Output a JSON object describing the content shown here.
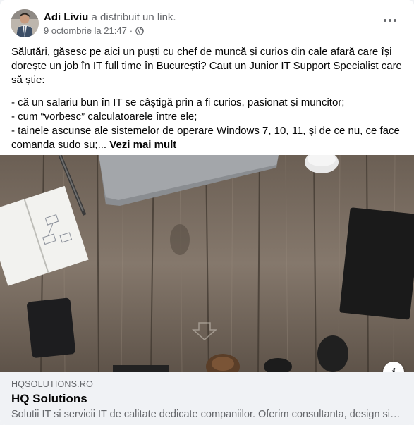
{
  "post": {
    "author_name": "Adi Liviu",
    "action_text": "a distribuit un link.",
    "timestamp": "9 octombrie la 21:47",
    "separator": "·",
    "privacy_icon": "globe-icon",
    "more_icon": "more-options-icon",
    "intro": "Sălutări, găsesc pe aici un puști cu chef de muncă și curios din cale afară care își dorește un job în IT full time în București? Caut un Junior IT Support Specialist care să știe:",
    "bullets": [
      "- că un salariu bun în IT se câștigă prin a fi curios, pasionat și muncitor;",
      "- cum “vorbesc” calculatoarele între ele;",
      "- tainele ascunse ale sistemelor de operare Windows 7, 10, 11, și de ce nu, ce face comanda sudo su;..."
    ],
    "see_more": "Vezi mai mult"
  },
  "link_preview": {
    "domain": "HQSOLUTIONS.RO",
    "title": "HQ Solutions",
    "description": "Solutii IT si servicii IT de calitate dedicate companiilor. Oferim consultanta, design si implementare de solutii IT.",
    "info_icon": "info-icon"
  },
  "colors": {
    "text_primary": "#050505",
    "text_secondary": "#65676b",
    "footer_bg": "#f0f2f5"
  }
}
